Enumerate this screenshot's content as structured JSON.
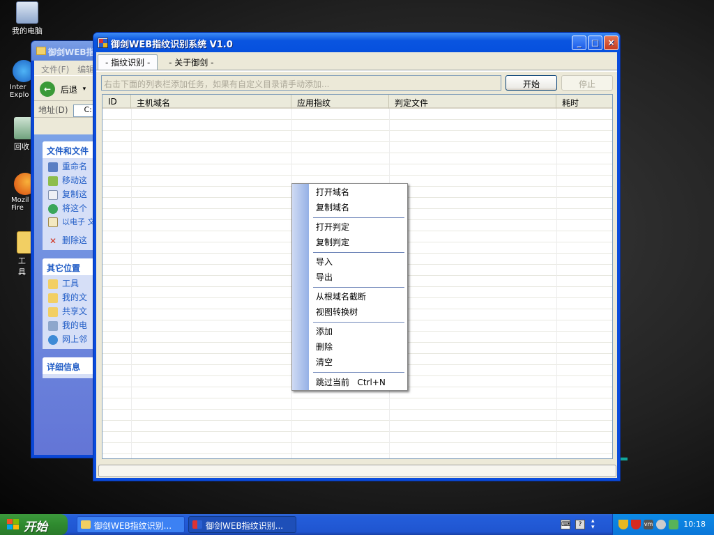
{
  "desktop": {
    "icons": [
      {
        "label": "我的电脑"
      },
      {
        "label": "Inter Explo"
      },
      {
        "label": "回收"
      },
      {
        "label": "Mozil Fire"
      },
      {
        "label": "工具"
      }
    ]
  },
  "explorer_window": {
    "title": "御剑WEB指",
    "menu_file": "文件(F)",
    "menu_edit": "编辑",
    "back_label": "后退",
    "address_label": "地址(D)",
    "address_value": "C:",
    "panes": [
      {
        "title": "文件和文件",
        "items": [
          "重命名",
          "移动这",
          "复制这",
          "将这个",
          "以电子 文件",
          "删除这"
        ]
      },
      {
        "title": "其它位置",
        "items": [
          "工具",
          "我的文",
          "共享文",
          "我的电",
          "网上邻"
        ]
      },
      {
        "title": "详细信息",
        "items": []
      }
    ]
  },
  "main_window": {
    "title": "御剑WEB指纹识别系统 V1.0",
    "controls": {
      "minimize": "_",
      "maximize": "□",
      "close": "×"
    },
    "tabs": [
      {
        "label": "- 指纹识别 -",
        "active": true
      },
      {
        "label": "- 关于御剑 -",
        "active": false
      }
    ],
    "task_input_placeholder": "右击下面的列表栏添加任务，如果有自定义目录请手动添加...",
    "start_button": "开始",
    "stop_button": "停止",
    "columns": [
      "ID",
      "主机域名",
      "应用指纹",
      "判定文件",
      "耗时"
    ],
    "rows": []
  },
  "context_menu": {
    "items": [
      "打开域名",
      "复制域名",
      "打开判定",
      "复制判定",
      "导入",
      "导出",
      "从根域名截断",
      "视图转换树",
      "添加",
      "删除",
      "清空",
      "跳过当前   Ctrl+N"
    ]
  },
  "taskbar": {
    "start_label": "开始",
    "tasks": [
      {
        "label": "御剑WEB指纹识别...",
        "active": false
      },
      {
        "label": "御剑WEB指纹识别...",
        "active": true
      }
    ],
    "clock": "10:18"
  },
  "colors": {
    "xp_blue": "#0a4cdc",
    "window_face": "#ece9d8",
    "start_green": "#2f8a2f",
    "tray_blue": "#0b77d9",
    "link_blue": "#215dc6"
  }
}
